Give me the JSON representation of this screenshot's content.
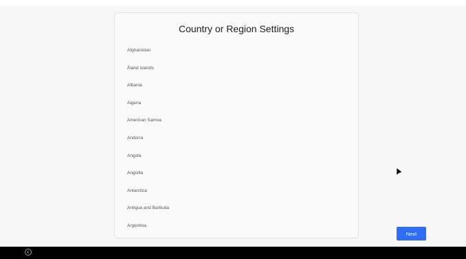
{
  "panel": {
    "title": "Country or Region Settings",
    "countries": [
      "Afghanistan",
      "Åland Islands",
      "Albania",
      "Algeria",
      "American Samoa",
      "Andorra",
      "Angola",
      "Anguilla",
      "Antarctica",
      "Antigua and Barbuda",
      "Argentina"
    ]
  },
  "actions": {
    "next_label": "Next"
  },
  "colors": {
    "accent": "#2f6df6",
    "background": "#f7f7f7",
    "taskbar": "#000000"
  },
  "icons": {
    "back": "back-icon",
    "cursor": "mouse-cursor-icon"
  }
}
